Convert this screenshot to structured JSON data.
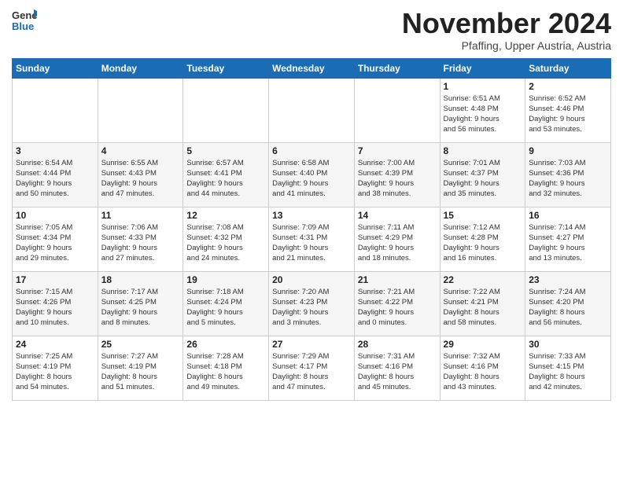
{
  "header": {
    "logo_line1": "General",
    "logo_line2": "Blue",
    "month_title": "November 2024",
    "location": "Pfaffing, Upper Austria, Austria"
  },
  "days_of_week": [
    "Sunday",
    "Monday",
    "Tuesday",
    "Wednesday",
    "Thursday",
    "Friday",
    "Saturday"
  ],
  "weeks": [
    [
      {
        "day": "",
        "info": ""
      },
      {
        "day": "",
        "info": ""
      },
      {
        "day": "",
        "info": ""
      },
      {
        "day": "",
        "info": ""
      },
      {
        "day": "",
        "info": ""
      },
      {
        "day": "1",
        "info": "Sunrise: 6:51 AM\nSunset: 4:48 PM\nDaylight: 9 hours\nand 56 minutes."
      },
      {
        "day": "2",
        "info": "Sunrise: 6:52 AM\nSunset: 4:46 PM\nDaylight: 9 hours\nand 53 minutes."
      }
    ],
    [
      {
        "day": "3",
        "info": "Sunrise: 6:54 AM\nSunset: 4:44 PM\nDaylight: 9 hours\nand 50 minutes."
      },
      {
        "day": "4",
        "info": "Sunrise: 6:55 AM\nSunset: 4:43 PM\nDaylight: 9 hours\nand 47 minutes."
      },
      {
        "day": "5",
        "info": "Sunrise: 6:57 AM\nSunset: 4:41 PM\nDaylight: 9 hours\nand 44 minutes."
      },
      {
        "day": "6",
        "info": "Sunrise: 6:58 AM\nSunset: 4:40 PM\nDaylight: 9 hours\nand 41 minutes."
      },
      {
        "day": "7",
        "info": "Sunrise: 7:00 AM\nSunset: 4:39 PM\nDaylight: 9 hours\nand 38 minutes."
      },
      {
        "day": "8",
        "info": "Sunrise: 7:01 AM\nSunset: 4:37 PM\nDaylight: 9 hours\nand 35 minutes."
      },
      {
        "day": "9",
        "info": "Sunrise: 7:03 AM\nSunset: 4:36 PM\nDaylight: 9 hours\nand 32 minutes."
      }
    ],
    [
      {
        "day": "10",
        "info": "Sunrise: 7:05 AM\nSunset: 4:34 PM\nDaylight: 9 hours\nand 29 minutes."
      },
      {
        "day": "11",
        "info": "Sunrise: 7:06 AM\nSunset: 4:33 PM\nDaylight: 9 hours\nand 27 minutes."
      },
      {
        "day": "12",
        "info": "Sunrise: 7:08 AM\nSunset: 4:32 PM\nDaylight: 9 hours\nand 24 minutes."
      },
      {
        "day": "13",
        "info": "Sunrise: 7:09 AM\nSunset: 4:31 PM\nDaylight: 9 hours\nand 21 minutes."
      },
      {
        "day": "14",
        "info": "Sunrise: 7:11 AM\nSunset: 4:29 PM\nDaylight: 9 hours\nand 18 minutes."
      },
      {
        "day": "15",
        "info": "Sunrise: 7:12 AM\nSunset: 4:28 PM\nDaylight: 9 hours\nand 16 minutes."
      },
      {
        "day": "16",
        "info": "Sunrise: 7:14 AM\nSunset: 4:27 PM\nDaylight: 9 hours\nand 13 minutes."
      }
    ],
    [
      {
        "day": "17",
        "info": "Sunrise: 7:15 AM\nSunset: 4:26 PM\nDaylight: 9 hours\nand 10 minutes."
      },
      {
        "day": "18",
        "info": "Sunrise: 7:17 AM\nSunset: 4:25 PM\nDaylight: 9 hours\nand 8 minutes."
      },
      {
        "day": "19",
        "info": "Sunrise: 7:18 AM\nSunset: 4:24 PM\nDaylight: 9 hours\nand 5 minutes."
      },
      {
        "day": "20",
        "info": "Sunrise: 7:20 AM\nSunset: 4:23 PM\nDaylight: 9 hours\nand 3 minutes."
      },
      {
        "day": "21",
        "info": "Sunrise: 7:21 AM\nSunset: 4:22 PM\nDaylight: 9 hours\nand 0 minutes."
      },
      {
        "day": "22",
        "info": "Sunrise: 7:22 AM\nSunset: 4:21 PM\nDaylight: 8 hours\nand 58 minutes."
      },
      {
        "day": "23",
        "info": "Sunrise: 7:24 AM\nSunset: 4:20 PM\nDaylight: 8 hours\nand 56 minutes."
      }
    ],
    [
      {
        "day": "24",
        "info": "Sunrise: 7:25 AM\nSunset: 4:19 PM\nDaylight: 8 hours\nand 54 minutes."
      },
      {
        "day": "25",
        "info": "Sunrise: 7:27 AM\nSunset: 4:19 PM\nDaylight: 8 hours\nand 51 minutes."
      },
      {
        "day": "26",
        "info": "Sunrise: 7:28 AM\nSunset: 4:18 PM\nDaylight: 8 hours\nand 49 minutes."
      },
      {
        "day": "27",
        "info": "Sunrise: 7:29 AM\nSunset: 4:17 PM\nDaylight: 8 hours\nand 47 minutes."
      },
      {
        "day": "28",
        "info": "Sunrise: 7:31 AM\nSunset: 4:16 PM\nDaylight: 8 hours\nand 45 minutes."
      },
      {
        "day": "29",
        "info": "Sunrise: 7:32 AM\nSunset: 4:16 PM\nDaylight: 8 hours\nand 43 minutes."
      },
      {
        "day": "30",
        "info": "Sunrise: 7:33 AM\nSunset: 4:15 PM\nDaylight: 8 hours\nand 42 minutes."
      }
    ]
  ]
}
